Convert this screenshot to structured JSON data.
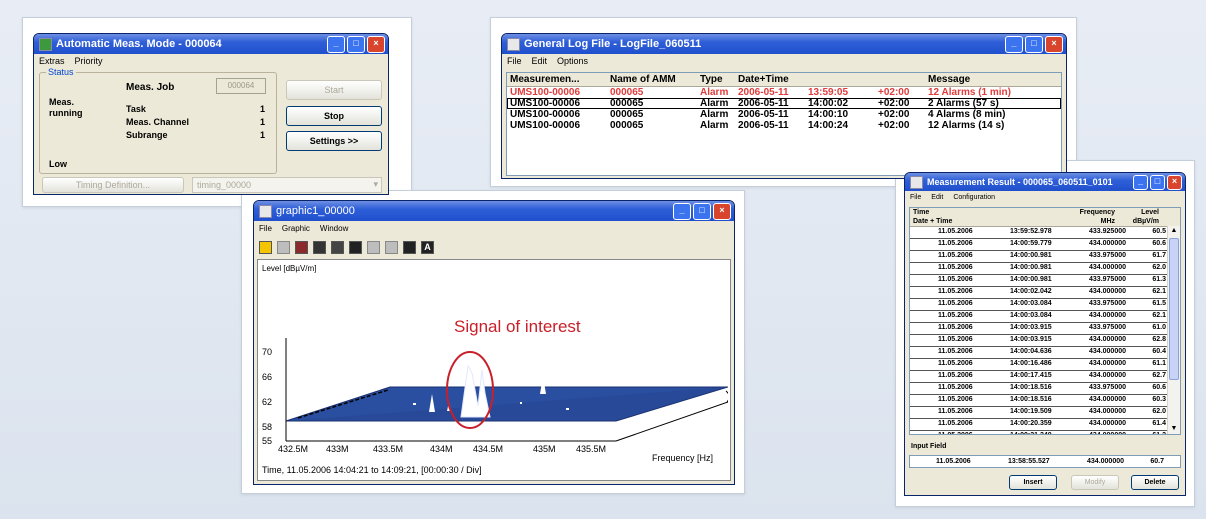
{
  "auto": {
    "title": "Automatic Meas. Mode - 000064",
    "menu": [
      "Extras",
      "Priority"
    ],
    "status_group": "Status",
    "left1": "Meas.",
    "left2": "running",
    "left3": "Low",
    "job_label": "Meas. Job",
    "job_value": "000064",
    "task_label": "Task",
    "task_value": "1",
    "channel_label": "Meas. Channel",
    "channel_value": "1",
    "subrange_label": "Subrange",
    "subrange_value": "1",
    "start": "Start",
    "stop": "Stop",
    "settings": "Settings >>",
    "timing_btn": "Timing Definition...",
    "timing_value": "timing_00000"
  },
  "log": {
    "title": "General Log File - LogFile_060511",
    "menu": [
      "File",
      "Edit",
      "Options"
    ],
    "headers": [
      "Measuremen...",
      "Name of AMM",
      "Type",
      "Date+Time",
      "Message"
    ],
    "rows": [
      [
        "UMS100-00006",
        "000065",
        "Alarm",
        "2006-05-11",
        "13:59:05",
        "+02:00",
        "12 Alarms (1 min)"
      ],
      [
        "UMS100-00006",
        "000065",
        "Alarm",
        "2006-05-11",
        "14:00:02",
        "+02:00",
        "2 Alarms (57 s)"
      ],
      [
        "UMS100-00006",
        "000065",
        "Alarm",
        "2006-05-11",
        "14:00:10",
        "+02:00",
        "4 Alarms (8 min)"
      ],
      [
        "UMS100-00006",
        "000065",
        "Alarm",
        "2006-05-11",
        "14:00:24",
        "+02:00",
        "12 Alarms (14 s)"
      ]
    ],
    "highlight_color": "#e03c3c"
  },
  "graphic": {
    "title": "graphic1_00000",
    "menu": [
      "File",
      "Graphic",
      "Window"
    ],
    "toolbar_last": "A",
    "ylabel": "Level [dBµV/m]",
    "yticks": [
      "70",
      "66",
      "62",
      "58",
      "55"
    ],
    "xticks": [
      "432.5M",
      "433M",
      "433.5M",
      "434M",
      "434.5M",
      "435M",
      "435.5M"
    ],
    "xlabel": "Frequency [Hz]",
    "footer": "Time, 11.05.2006 14:04:21 to 14:09:21, [00:00:30 / Div]",
    "annotation": "Signal of interest",
    "annotation_color": "#c8202a",
    "surface_color": "#2a4fa0"
  },
  "mr": {
    "title": "Measurement Result - 000065_060511_0101",
    "menu": [
      "File",
      "Edit",
      "Configuration"
    ],
    "h1": [
      "Time",
      "Frequency",
      "Level"
    ],
    "h2": [
      "Date + Time",
      "MHz",
      "dBµV/m"
    ],
    "rows": [
      [
        "11.05.2006",
        "13:59:52.978",
        "433.925000",
        "60.5"
      ],
      [
        "11.05.2006",
        "14:00:59.779",
        "434.000000",
        "60.6"
      ],
      [
        "11.05.2006",
        "14:00:00.981",
        "433.975000",
        "61.7"
      ],
      [
        "11.05.2006",
        "14:00:00.981",
        "434.000000",
        "62.0"
      ],
      [
        "11.05.2006",
        "14:00:00.981",
        "433.975000",
        "61.3"
      ],
      [
        "11.05.2006",
        "14:00:02.042",
        "434.000000",
        "62.1"
      ],
      [
        "11.05.2006",
        "14:00:03.084",
        "433.975000",
        "61.5"
      ],
      [
        "11.05.2006",
        "14:00:03.084",
        "434.000000",
        "62.1"
      ],
      [
        "11.05.2006",
        "14:00:03.915",
        "433.975000",
        "61.0"
      ],
      [
        "11.05.2006",
        "14:00:03.915",
        "434.000000",
        "62.8"
      ],
      [
        "11.05.2006",
        "14:00:04.636",
        "434.000000",
        "60.4"
      ],
      [
        "11.05.2006",
        "14:00:16.486",
        "434.000000",
        "61.1"
      ],
      [
        "11.05.2006",
        "14:00:17.415",
        "434.000000",
        "62.7"
      ],
      [
        "11.05.2006",
        "14:00:18.516",
        "433.975000",
        "60.6"
      ],
      [
        "11.05.2006",
        "14:00:18.516",
        "434.000000",
        "60.3"
      ],
      [
        "11.05.2006",
        "14:00:19.509",
        "434.000000",
        "62.0"
      ],
      [
        "11.05.2006",
        "14:00:20.359",
        "434.000000",
        "61.4"
      ],
      [
        "11.05.2006",
        "14:00:21.240",
        "434.000000",
        "61.2"
      ]
    ],
    "input_label": "Input Field",
    "input_row": [
      "11.05.2006",
      "13:58:55.527",
      "434.000000",
      "60.7"
    ],
    "insert": "Insert",
    "modify": "Modify",
    "delete": "Delete"
  }
}
